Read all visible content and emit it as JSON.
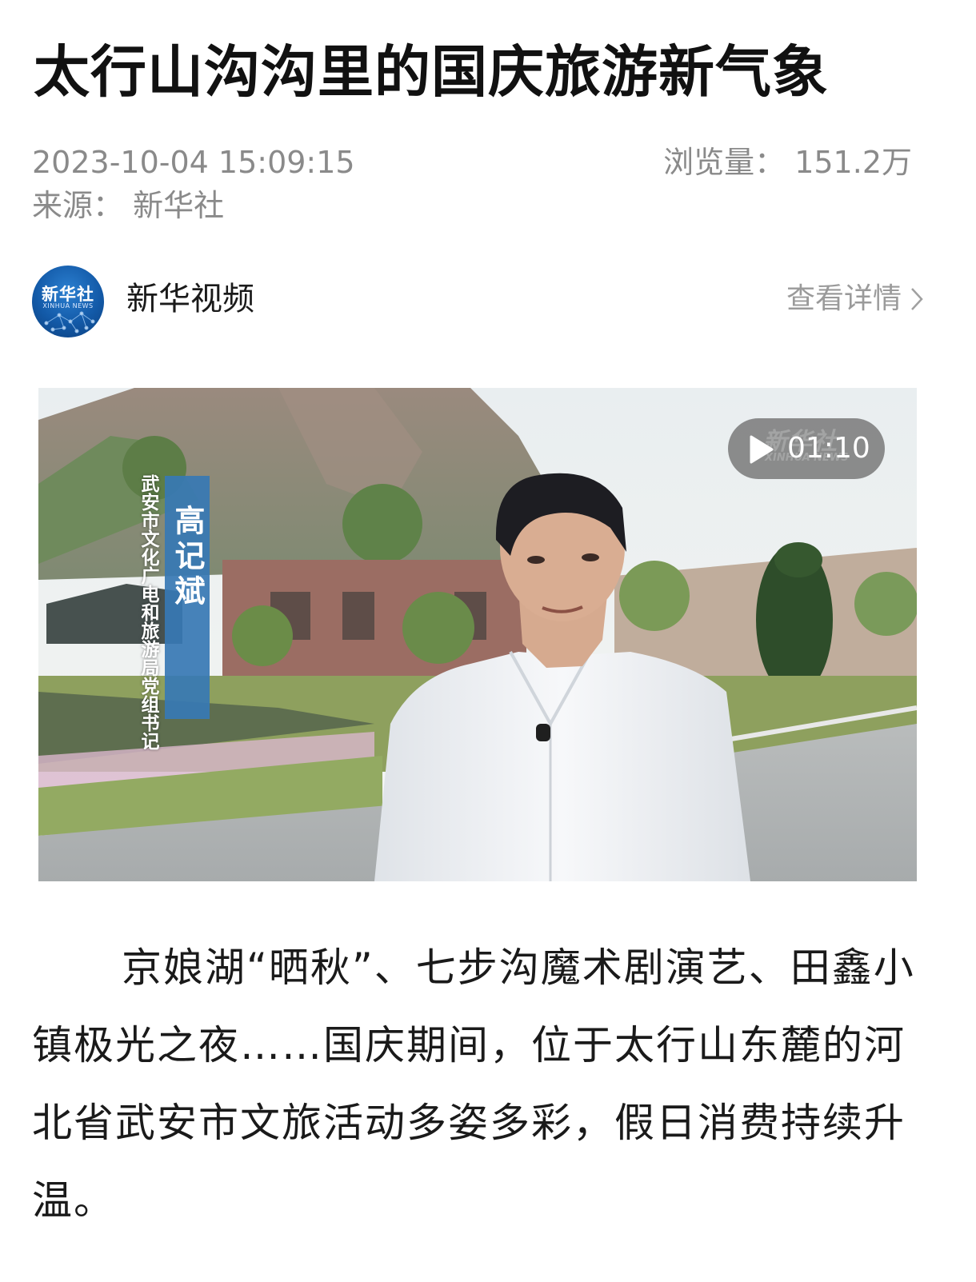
{
  "article": {
    "title": "太行山沟沟里的国庆旅游新气象",
    "timestamp": "2023-10-04 15:09:15",
    "views_label": "浏览量：",
    "views_value": "151.2万",
    "source_label": "来源：",
    "source_value": "新华社"
  },
  "channel": {
    "avatar_text": "新华社",
    "avatar_sub": "XINHUA NEWS",
    "name": "新华视频",
    "details_label": "查看详情",
    "details_icon": "chevron-right-icon"
  },
  "video": {
    "speaker_name": "高记斌",
    "speaker_title": "武安市文化广电和旅游局党组书记",
    "duration": "01:10",
    "watermark": "新华社",
    "watermark_sub": "XINHUA NEWS",
    "play_icon": "play-icon"
  },
  "body": {
    "paragraph1": "京娘湖“晒秋”、七步沟魔术剧演艺、田鑫小镇极光之夜……国庆期间，位于太行山东麓的河北省武安市文旅活动多姿多彩，假日消费持续升温。"
  },
  "colors": {
    "meta_gray": "#8a8a8a",
    "name_tag_blue": "#3778b4",
    "avatar_blue": "#135aa8"
  }
}
